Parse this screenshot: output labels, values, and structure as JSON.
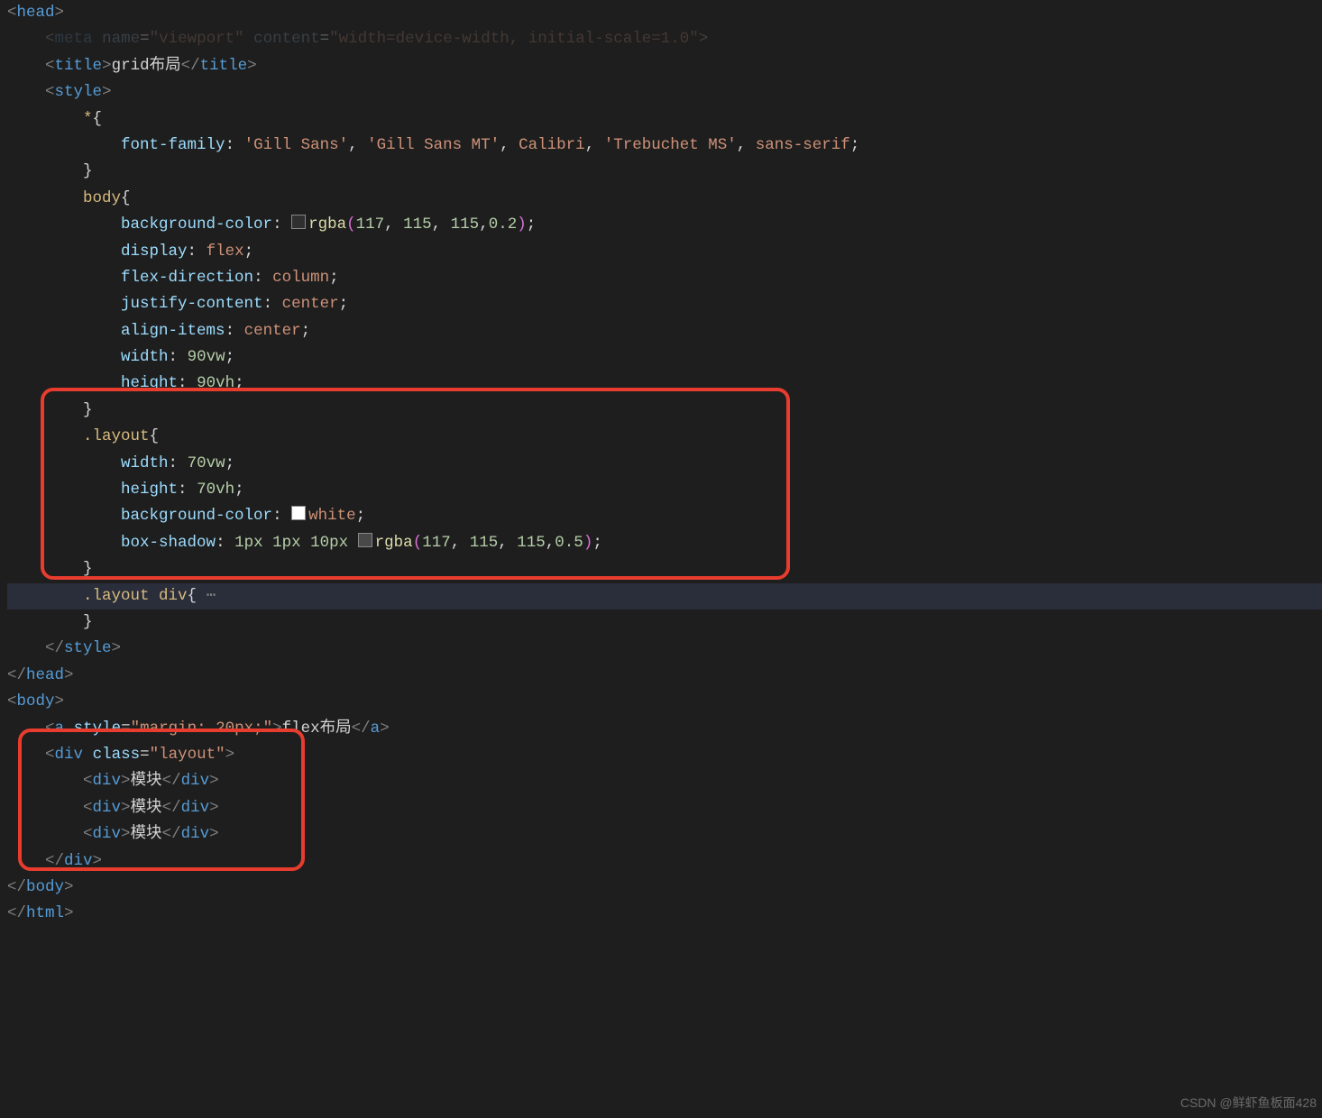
{
  "watermark": "CSDN @鲜虾鱼板面428",
  "code": {
    "head_open": "<head>",
    "meta_line": "    <meta name=\"viewport\" content=\"width=device-width, initial-scale=1.0\">",
    "title_text": "grid布局",
    "style_open": "<style>",
    "sel_star": "*",
    "font_family_prop": "font-family",
    "font_family_val": "'Gill Sans', 'Gill Sans MT', Calibri, 'Trebuchet MS', sans-serif",
    "sel_body": "body",
    "bgcolor_prop": "background-color",
    "rgba_fn": "rgba",
    "bgcolor_args": "117, 115, 115,0.2",
    "display_prop": "display",
    "display_val": "flex",
    "flexdir_prop": "flex-direction",
    "flexdir_val": "column",
    "justify_prop": "justify-content",
    "justify_val": "center",
    "align_prop": "align-items",
    "align_val": "center",
    "width_prop": "width",
    "width_val": "90vw",
    "height_prop": "height",
    "height_val": "90vh",
    "sel_layout": ".layout",
    "layout_width": "70vw",
    "layout_height": "70vh",
    "layout_bg": "white",
    "boxshadow_prop": "box-shadow",
    "boxshadow_val_prefix": "1px 1px 10px",
    "boxshadow_rgba_args": "117, 115, 115,0.5",
    "sel_layout_div": ".layout div",
    "style_close": "</style>",
    "head_close": "</head>",
    "body_open": "<body>",
    "a_tag": "a",
    "a_style": "margin: 20px;",
    "a_text": "flex布局",
    "div_tag": "div",
    "div_class": "layout",
    "module_text": "模块",
    "body_close": "</body>",
    "html_close": "</html>"
  }
}
